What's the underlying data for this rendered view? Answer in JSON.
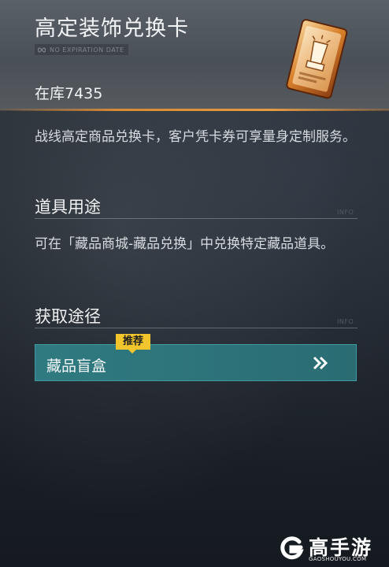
{
  "item": {
    "title": "高定装饰兑换卡",
    "expiration_label": "NO EXPIRATION DATE",
    "stock": "在库7435",
    "description": "战线高定商品兑换卡，客户凭卡券可享量身定制服务。",
    "icon": "gold-exchange-card-icon"
  },
  "usage": {
    "heading": "道具用途",
    "info_tag": "INFO",
    "text": "可在「藏品商城-藏品兑换」中兑换特定藏品道具。"
  },
  "source": {
    "heading": "获取途径",
    "info_tag": "INFO",
    "badge": "推荐",
    "item_label": "藏品盲盒",
    "arrow_icon": "double-chevron-right-icon"
  },
  "watermark": {
    "brand": "高手游",
    "url": "GAOSHOUYOU.COM"
  },
  "colors": {
    "accent_orange": "#e59a44",
    "button_teal": "#2f7a80",
    "badge_yellow": "#f3c52c"
  }
}
